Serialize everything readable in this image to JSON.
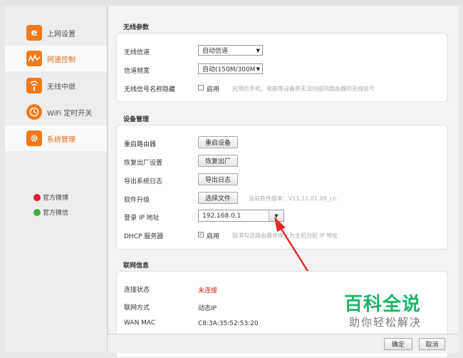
{
  "sidebar": {
    "items": [
      {
        "label": "上网设置",
        "icon": "ie-icon",
        "color": "#f07a1c"
      },
      {
        "label": "网速控制",
        "icon": "wave-icon",
        "color": "#f07a1c"
      },
      {
        "label": "无线中继",
        "icon": "signal-icon",
        "color": "#f07a1c"
      },
      {
        "label": "WiFi 定时开关",
        "icon": "clock-icon",
        "color": "#f07a1c"
      },
      {
        "label": "系统管理",
        "icon": "gear-icon",
        "color": "#f07a1c"
      }
    ],
    "social": [
      "官方微博",
      "官方微信"
    ]
  },
  "wireless": {
    "title": "无线参数",
    "channel_label": "无线信道",
    "channel_value": "自动信道",
    "bandwidth_label": "信道频宽",
    "bandwidth_value": "自动(150M/300M",
    "hide_label": "无线信号名称隐藏",
    "hide_option": "启用",
    "hide_hint": "启用后手机，电脑等设备将无法扫描到路由器的无线信号"
  },
  "device": {
    "title": "设备管理",
    "reboot_label": "重启路由器",
    "reboot_btn": "重启设备",
    "reset_label": "恢复出厂设置",
    "reset_btn": "恢复出厂",
    "log_label": "导出系统日志",
    "log_btn": "导出日志",
    "upgrade_label": "软件升级",
    "upgrade_btn": "选择文件",
    "upgrade_hint": "当前软件版本：V11.11.01.09_cn",
    "ip_label": "登录 IP 地址",
    "ip_value": "192.168.0.1",
    "dhcp_label": "DHCP 服务器",
    "dhcp_option": "启用",
    "dhcp_hint": "取消勾选路由器将停止为主机分配 IP 地址"
  },
  "network": {
    "title": "联网信息",
    "status_label": "连接状态",
    "status_value": "未连接",
    "mode_label": "联网方式",
    "mode_value": "动态IP",
    "wanmac_label": "WAN MAC",
    "wanmac_value": "C8:3A:35:52:53:20"
  },
  "footer": {
    "ok": "确定",
    "cancel": "取消"
  },
  "watermark": {
    "title": "百科全说",
    "subtitle": "助你轻松解决"
  },
  "colors": {
    "accent": "#e36a14",
    "status_error": "#e0201a",
    "arrow": "#e02c2c"
  }
}
